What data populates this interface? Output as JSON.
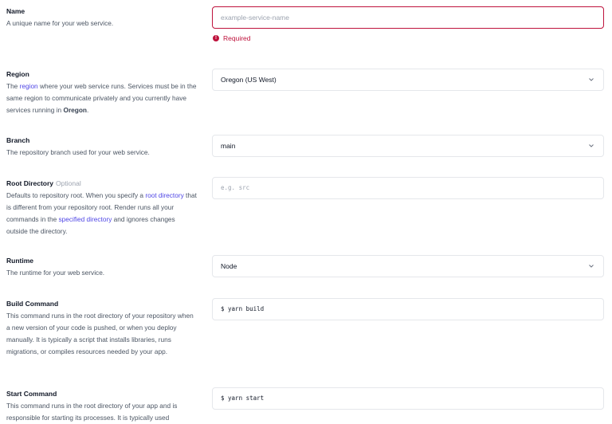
{
  "name_section": {
    "title": "Name",
    "desc": "A unique name for your web service.",
    "placeholder": "example-service-name",
    "error_icon": "exclamation-circle-icon",
    "error_text": "Required"
  },
  "region_section": {
    "title": "Region",
    "desc_1": "The ",
    "desc_link": "region",
    "desc_2": " where your web service runs. Services must be in the same region to communicate privately and you currently have services running in ",
    "desc_bold": "Oregon",
    "desc_3": ".",
    "value": "Oregon (US West)"
  },
  "branch_section": {
    "title": "Branch",
    "desc": "The repository branch used for your web service.",
    "value": "main"
  },
  "root_section": {
    "title": "Root Directory",
    "optional": "Optional",
    "desc_1": "Defaults to repository root. When you specify a ",
    "desc_link1": "root directory",
    "desc_2": " that is different from your repository root. Render runs all your commands in the ",
    "desc_link2": "specified directory",
    "desc_3": " and ignores changes outside the directory.",
    "placeholder": "e.g. src"
  },
  "runtime_section": {
    "title": "Runtime",
    "desc": "The runtime for your web service.",
    "value": "Node"
  },
  "build_section": {
    "title": "Build Command",
    "desc": "This command runs in the root directory of your repository when a new version of your code is pushed, or when you deploy manually. It is typically a script that installs libraries, runs migrations, or compiles resources needed by your app.",
    "value": "$ yarn build"
  },
  "start_section": {
    "title": "Start Command",
    "desc": "This command runs in the root directory of your app and is responsible for starting its processes. It is typically used",
    "value": "$ yarn start"
  },
  "colors": {
    "error": "#be123c",
    "link": "#4f46e5",
    "border": "#e5e7eb"
  },
  "icons": {
    "select": "chevron-down-icon"
  }
}
